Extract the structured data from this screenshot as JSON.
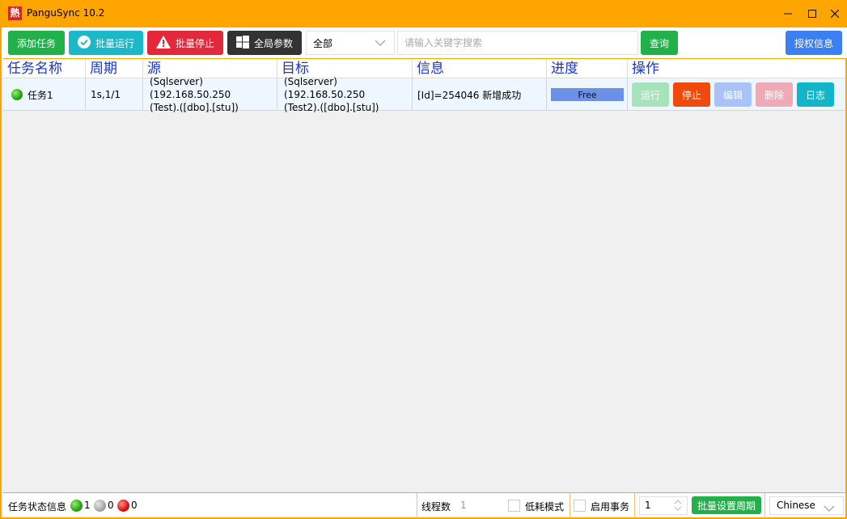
{
  "window": {
    "title": "PanguSync 10.2",
    "icon_glyph": "熱",
    "accent_color": "#ffa500"
  },
  "toolbar": {
    "add_task_label": "添加任务",
    "batch_run_label": "批量运行",
    "batch_stop_label": "批量停止",
    "global_params_label": "全局参数",
    "filter_selected": "全部",
    "search_placeholder": "请输入关键字搜索",
    "query_label": "查询",
    "license_label": "授权信息"
  },
  "table": {
    "headers": [
      "任务名称",
      "周期",
      "源",
      "目标",
      "信息",
      "进度",
      "操作"
    ],
    "rows": [
      {
        "name": "任务1",
        "status": "running",
        "period": "1s,1/1",
        "source_line1": "(Sqlserver)(192.168.50.250",
        "source_line2": "(Test).([dbo].[stu])",
        "target_line1": "(Sqlserver)(192.168.50.250",
        "target_line2": "(Test2).([dbo].[stu])",
        "info": "[Id]=254046 新增成功",
        "progress": "Free",
        "actions": {
          "run": "运行",
          "stop": "停止",
          "edit": "编辑",
          "delete": "删除",
          "log": "日志"
        }
      }
    ]
  },
  "statusbar": {
    "task_status_label": "任务状态信息",
    "running_count": "1",
    "stopped_count": "0",
    "error_count": "0",
    "threads_label": "线程数",
    "threads_value": "1",
    "low_power_label": "低耗模式",
    "enable_transaction_label": "启用事务",
    "period_value": "1",
    "batch_period_label": "批量设置周期",
    "language": "Chinese"
  }
}
